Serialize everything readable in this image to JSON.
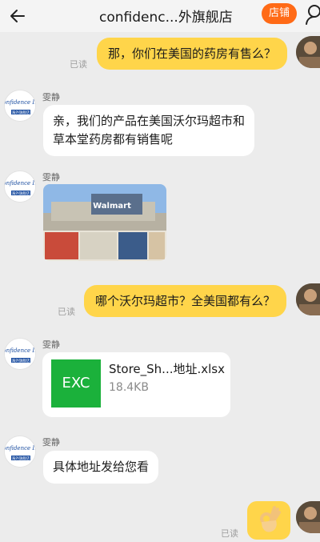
{
  "header": {
    "title": "confidenc...外旗舰店",
    "shop_label": "店铺"
  },
  "icons": {
    "back": "back-arrow-icon",
    "profile": "profile-icon",
    "ok_hand": "ok-hand-emoji-icon"
  },
  "colors": {
    "shop_button": "#ff6a16",
    "outgoing_bubble": "#ffd54a",
    "incoming_bubble": "#ffffff",
    "file_icon": "#1bb13b"
  },
  "messages": [
    {
      "direction": "out",
      "text": "那，你们在美国的药房有售么？",
      "status": "已读"
    },
    {
      "direction": "in",
      "sender": "雯静",
      "lines": [
        "亲，我们的产品在美国沃尔玛超市和",
        "草本堂药房都有销售呢"
      ]
    },
    {
      "direction": "in",
      "sender": "雯静",
      "type": "image",
      "image_text": "Walmart"
    },
    {
      "direction": "out",
      "text": "哪个沃尔玛超市？全美国都有么？",
      "status": "已读"
    },
    {
      "direction": "in",
      "sender": "雯静",
      "type": "file",
      "file_badge": "EXC",
      "file_name": "Store_Sh...地址.xlsx",
      "file_size": "18.4KB"
    },
    {
      "direction": "in",
      "sender": "雯静",
      "text": "具体地址发给您看"
    },
    {
      "direction": "out",
      "type": "emoji",
      "status": "已读"
    }
  ],
  "shop_logo": {
    "brand": "Confidence Inc.",
    "sub": "海外旗舰店"
  }
}
